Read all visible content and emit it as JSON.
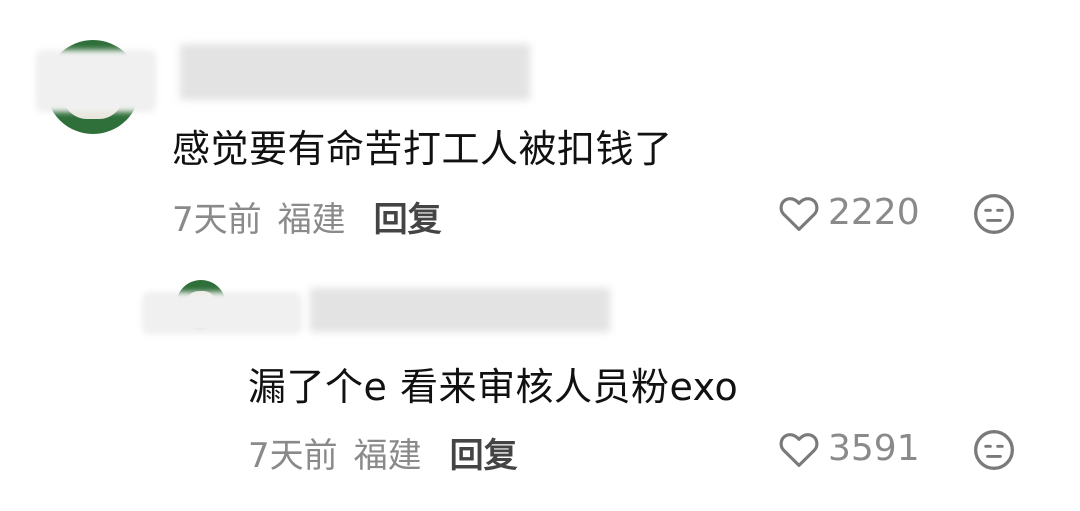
{
  "comments": [
    {
      "text": "感觉要有命苦打工人被扣钱了",
      "time": "7天前",
      "location": "福建",
      "reply_label": "回复",
      "likes": "2220"
    },
    {
      "text": "漏了个e 看来审核人员粉exo",
      "time": "7天前",
      "location": "福建",
      "reply_label": "回复",
      "likes": "3591"
    }
  ],
  "icons": {
    "like": "heart-outline-icon",
    "dislike": "neutral-face-icon"
  },
  "colors": {
    "avatar_green": "#2f6f3a",
    "meta_gray": "#8a8a8a",
    "text": "#111111"
  }
}
